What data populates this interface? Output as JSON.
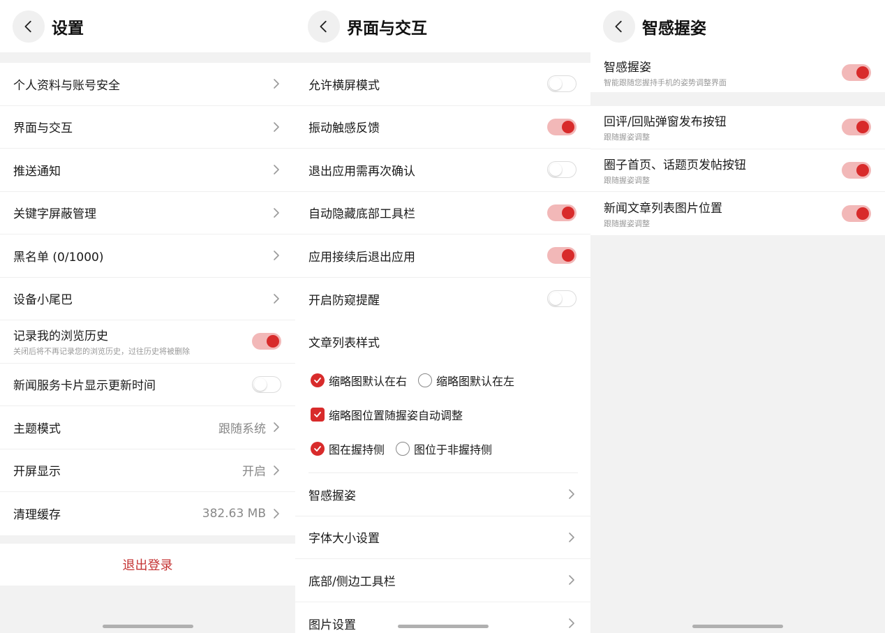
{
  "screens": {
    "settings": {
      "title": "设置",
      "items": [
        {
          "label": "个人资料与账号安全"
        },
        {
          "label": "界面与交互"
        },
        {
          "label": "推送通知"
        },
        {
          "label": "关键字屏蔽管理"
        },
        {
          "label": "黑名单 (0/1000)"
        },
        {
          "label": "设备小尾巴"
        },
        {
          "label": "记录我的浏览历史",
          "sub": "关闭后将不再记录您的浏览历史，过往历史将被删除",
          "toggle": true
        },
        {
          "label": "新闻服务卡片显示更新时间",
          "toggle": false
        },
        {
          "label": "主题模式",
          "value": "跟随系统"
        },
        {
          "label": "开屏显示",
          "value": "开启"
        },
        {
          "label": "清理缓存",
          "value": "382.63 MB"
        }
      ],
      "logout_label": "退出登录"
    },
    "interface": {
      "title": "界面与交互",
      "toggles": [
        {
          "label": "允许横屏模式",
          "on": false
        },
        {
          "label": "振动触感反馈",
          "on": true
        },
        {
          "label": "退出应用需再次确认",
          "on": false
        },
        {
          "label": "自动隐藏底部工具栏",
          "on": true
        },
        {
          "label": "应用接续后退出应用",
          "on": true
        },
        {
          "label": "开启防窥提醒",
          "on": false
        }
      ],
      "article_style_title": "文章列表样式",
      "options": {
        "thumb_right": "缩略图默认在右",
        "thumb_left": "缩略图默认在左",
        "thumb_auto": "缩略图位置随握姿自动调整",
        "img_hold_side": "图在握持侧",
        "img_non_hold_side": "图位于非握持侧"
      },
      "nav_items": [
        {
          "label": "智感握姿"
        },
        {
          "label": "字体大小设置"
        },
        {
          "label": "底部/侧边工具栏"
        },
        {
          "label": "图片设置"
        }
      ]
    },
    "grip": {
      "title": "智感握姿",
      "main": {
        "label": "智感握姿",
        "sub": "智能跟随您握持手机的姿势调整界面",
        "on": true
      },
      "items": [
        {
          "label": "回评/回贴弹窗发布按钮",
          "sub": "跟随握姿调整",
          "on": true
        },
        {
          "label": "圈子首页、话题页发帖按钮",
          "sub": "跟随握姿调整",
          "on": true
        },
        {
          "label": "新闻文章列表图片位置",
          "sub": "跟随握姿调整",
          "on": true
        }
      ]
    }
  },
  "colors": {
    "accent": "#d82b2b",
    "toggle_track_on": "#f2b8b8",
    "logout_text": "#c43333"
  },
  "icons": {
    "back": "chevron-left-icon",
    "row": "chevron-right-icon"
  }
}
